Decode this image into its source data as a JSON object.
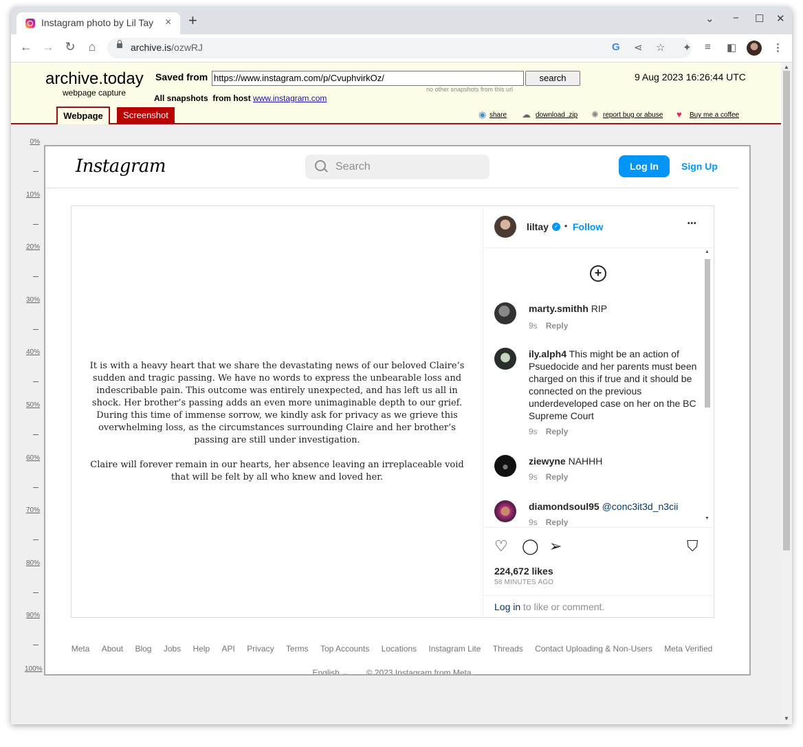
{
  "browser": {
    "tab_title": "Instagram photo by Lil Tay",
    "tab_close": "×",
    "new_tab": "+",
    "win_controls": [
      "⌄",
      "−",
      "☐",
      "✕"
    ],
    "url_host": "archive.is",
    "url_path": "/ozwRJ"
  },
  "archive": {
    "brand": "archive.today",
    "subtitle": "webpage capture",
    "saved_from_label": "Saved from",
    "saved_url": "https://www.instagram.com/p/CvuphvirkOz/",
    "search_button": "search",
    "no_snapshots": "no other snapshots from this url",
    "date": "9 Aug 2023 16:26:44 UTC",
    "all_snapshots_label": "All snapshots",
    "from_host_label": "from host",
    "host_link": "www.instagram.com",
    "tab_webpage": "Webpage",
    "tab_screenshot": "Screenshot",
    "links": {
      "share": "share",
      "download": "download .zip",
      "report": "report bug or abuse",
      "coffee": "Buy me a coffee"
    },
    "ruler": [
      "0%",
      "10%",
      "20%",
      "30%",
      "40%",
      "50%",
      "60%",
      "70%",
      "80%",
      "90%",
      "100%"
    ]
  },
  "instagram": {
    "logo": "Instagram",
    "search_placeholder": "Search",
    "login": "Log In",
    "signup": "Sign Up",
    "post_text": [
      "It is with a heavy heart that we share the devastating news of our beloved Claire’s sudden and tragic passing. We have no words to express the unbearable loss and indescribable pain. This outcome was entirely unexpected, and has left us all in shock. Her brother’s passing adds an even more unimaginable depth to our grief. During this time of immense sorrow, we kindly ask for privacy as we grieve this overwhelming loss, as the circumstances surrounding Claire and her brother’s passing are still under investigation.",
      "Claire will forever remain in our hearts, her absence leaving an irreplaceable void that will be felt by all who knew and loved her."
    ],
    "author": "liltay",
    "separator": "•",
    "follow": "Follow",
    "more": "•••",
    "comments": [
      {
        "user": "marty.smithh",
        "text": "RIP",
        "time": "9s",
        "reply": "Reply"
      },
      {
        "user": "ily.alph4",
        "text": "This might be an action of Psuedocide and her parents must been charged on this if true and it should be connected on the previous underdeveloped case on her on the BC Supreme Court",
        "time": "9s",
        "reply": "Reply"
      },
      {
        "user": "ziewyne",
        "text": "NAHHH",
        "time": "9s",
        "reply": "Reply"
      },
      {
        "user": "diamondsoul95",
        "text": "@conc3it3d_n3cii",
        "time": "9s",
        "reply": "Reply"
      }
    ],
    "likes": "224,672 likes",
    "time_ago": "58 MINUTES AGO",
    "login_link": "Log in",
    "login_suffix": " to like or comment.",
    "footer_links": [
      "Meta",
      "About",
      "Blog",
      "Jobs",
      "Help",
      "API",
      "Privacy",
      "Terms",
      "Top Accounts",
      "Locations",
      "Instagram Lite",
      "Threads",
      "Contact Uploading & Non-Users",
      "Meta Verified"
    ],
    "language": "English ⌄",
    "copyright": "© 2023 Instagram from Meta"
  },
  "colors": {
    "archive_bg": "#fefee8",
    "archive_red": "#a01010",
    "ig_blue": "#0095f6"
  }
}
